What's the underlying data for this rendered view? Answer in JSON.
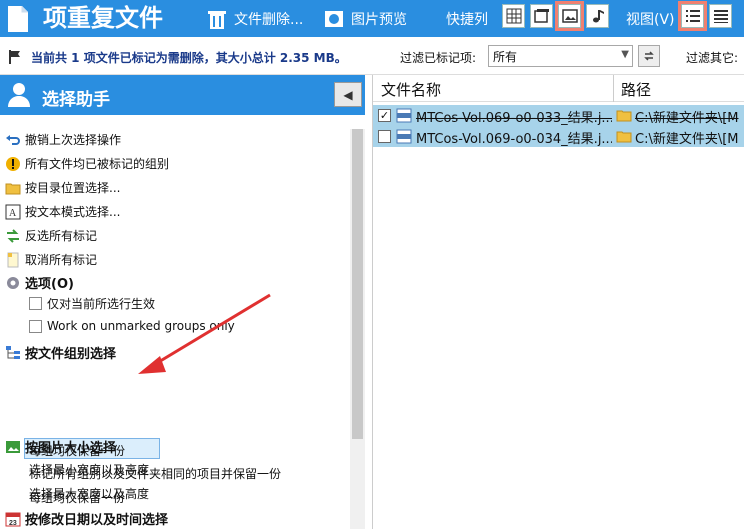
{
  "titlebar": {
    "title": "项重复文件",
    "delete_label": "文件删除...",
    "preview_label": "图片预览",
    "quick_label": "快捷列",
    "view_label": "视图(V)"
  },
  "status": {
    "text": "当前共 1 项文件已标记为需删除，其大小总计 2.35 MB。",
    "filter_marked_label": "过滤已标记项:",
    "filter_value": "所有",
    "filter_other_label": "过滤其它:"
  },
  "assistant": {
    "title": "选择助手",
    "actions": [
      {
        "label": "撤销上次选择操作",
        "icon": "undo-icon"
      },
      {
        "label": "所有文件均已被标记的组别",
        "icon": "warning-icon"
      },
      {
        "label": "按目录位置选择...",
        "icon": "folder-icon"
      },
      {
        "label": "按文本模式选择...",
        "icon": "text-icon"
      },
      {
        "label": "反选所有标记",
        "icon": "invert-icon"
      },
      {
        "label": "取消所有标记",
        "icon": "clear-icon"
      }
    ],
    "options_title": "选项(O)",
    "option1": "仅对当前所选行生效",
    "option2": "Work on unmarked groups only",
    "group_title": "按文件组别选择",
    "group_items": [
      "每组均仅保留一份",
      "标记所有组别以及文件夹相同的项目并保留一份",
      "每组均仅保留一份"
    ],
    "size_title": "按图片大小选择",
    "size_items": [
      "选择最小宽度以及高度",
      "选择最大宽度以及高度"
    ],
    "date_title": "按修改日期以及时间选择"
  },
  "grid": {
    "col_name": "文件名称",
    "col_path": "路径",
    "rows": [
      {
        "checked": "✓",
        "name": "MTCos-Vol.069-o0-033_结果.j...",
        "path": "C:\\新建文件夹\\[M"
      },
      {
        "checked": "",
        "name": "MTCos-Vol.069-o0-034_结果.j...",
        "path": "C:\\新建文件夹\\[M"
      }
    ]
  }
}
